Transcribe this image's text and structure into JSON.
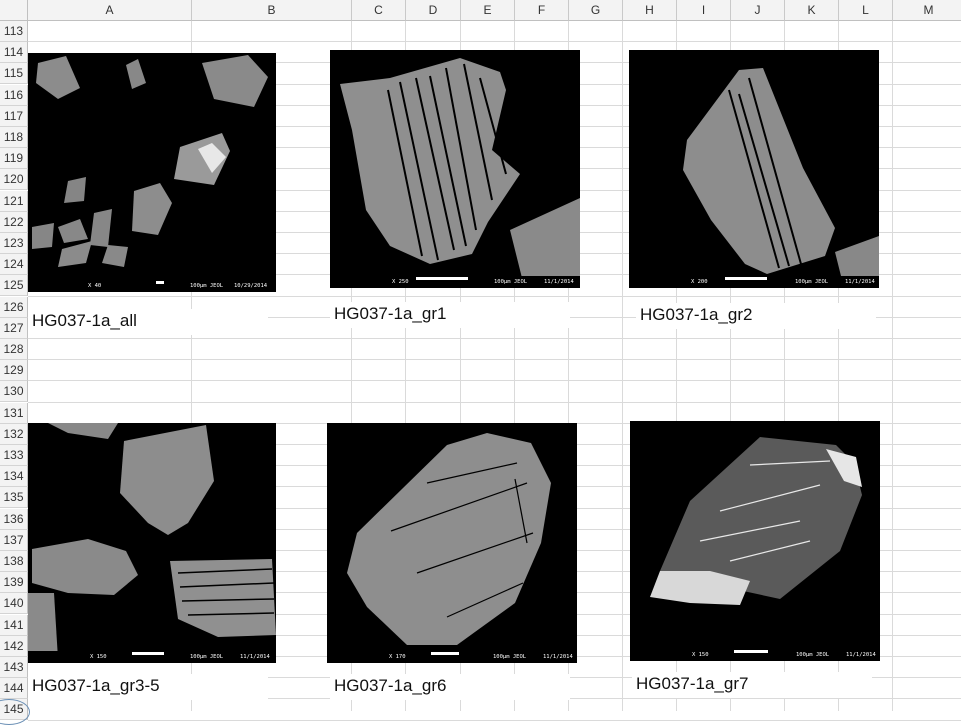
{
  "columns": [
    "A",
    "B",
    "C",
    "D",
    "E",
    "F",
    "G",
    "H",
    "I",
    "J",
    "K",
    "L",
    "M"
  ],
  "rows": [
    "113",
    "114",
    "115",
    "116",
    "117",
    "118",
    "119",
    "120",
    "121",
    "122",
    "123",
    "124",
    "125",
    "126",
    "127",
    "128",
    "129",
    "130",
    "131",
    "132",
    "133",
    "134",
    "135",
    "136",
    "137",
    "138",
    "139",
    "140",
    "141",
    "142",
    "143",
    "144",
    "145"
  ],
  "images": [
    {
      "label": "HG037-1a_all",
      "mag": "X 40",
      "kv": "25.0kV COMPO",
      "mode": "NOR",
      "scale": "100µm JEOL",
      "wd": "WD 11.0mm 17:56:38",
      "date": "10/29/2014"
    },
    {
      "label": "HG037-1a_gr1",
      "mag": "X 250",
      "kv": "25.0kV COMPO",
      "mode": "NOR",
      "scale": "100µm JEOL",
      "wd": "WD 11.0mm 13:54:00",
      "date": "11/1/2014"
    },
    {
      "label": "HG037-1a_gr2",
      "mag": "X 200",
      "kv": "25.0kV COMPO",
      "mode": "NOR",
      "scale": "100µm JEOL",
      "wd": "WD 11.0mm 13:55:04",
      "date": "11/1/2014"
    },
    {
      "label": "HG037-1a_gr3-5",
      "mag": "X 150",
      "kv": "25.0kV COMPO",
      "mode": "NOR",
      "scale": "100µm JEOL",
      "wd": "WD 11.0mm 13:55:44",
      "date": "11/1/2014"
    },
    {
      "label": "HG037-1a_gr6",
      "mag": "X 170",
      "kv": "25.0kV COMPO",
      "mode": "NOR",
      "scale": "100µm JEOL",
      "wd": "WD 11.0mm 13:57:46",
      "date": "11/1/2014"
    },
    {
      "label": "HG037-1a_gr7",
      "mag": "X 150",
      "kv": "25.0kV COMPO",
      "mode": "NOR",
      "scale": "100µm JEOL",
      "wd": "WD 11.0mm 13:59:47",
      "date": "11/1/2014"
    }
  ],
  "colors": {
    "header_bg": "#f3f3f3",
    "gridline": "#dadada",
    "grain": "#8a8a8a"
  }
}
